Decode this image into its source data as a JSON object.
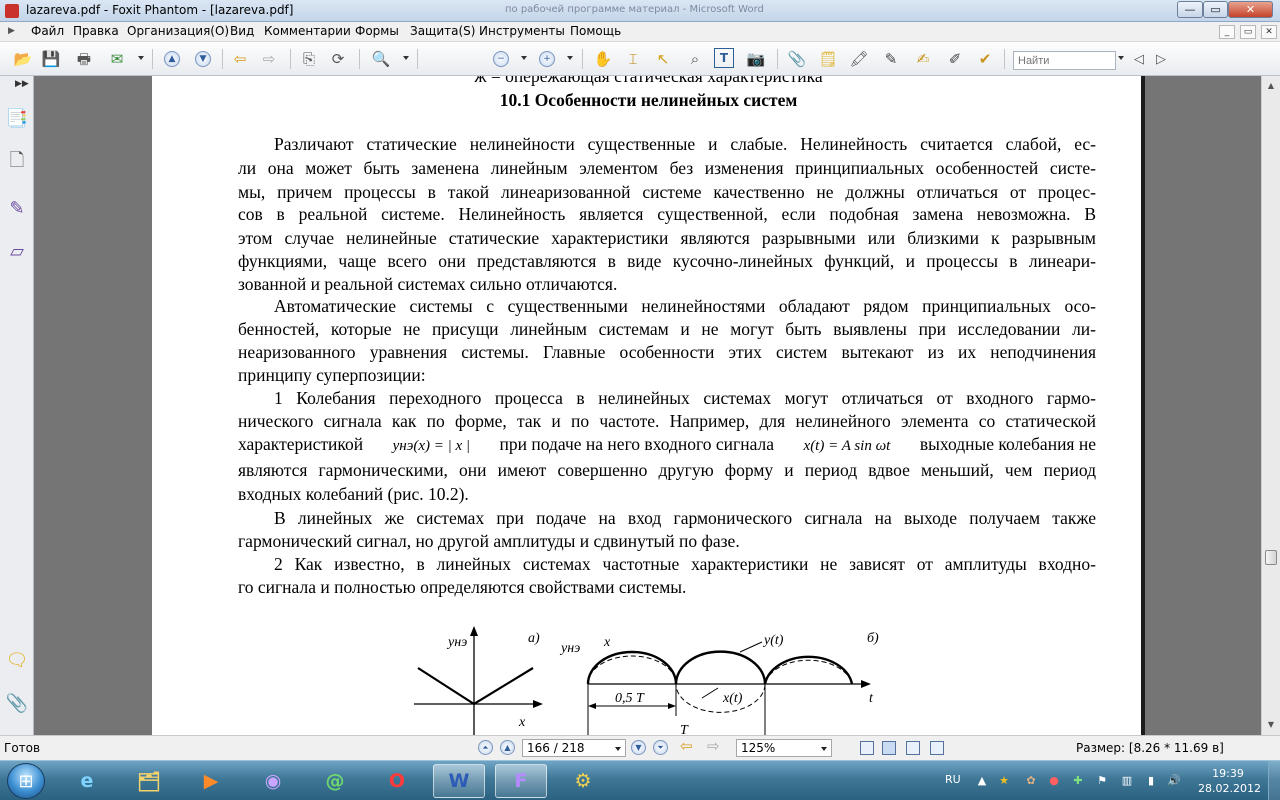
{
  "window": {
    "title": "lazareva.pdf - Foxit Phantom - [lazareva.pdf]",
    "background_title": "по рабочей программе материал - Microsoft Word",
    "min_glyph": "—",
    "max_glyph": "▭",
    "close_glyph": "✕"
  },
  "menu": {
    "items": [
      "Файл",
      "Правка",
      "Организация(О)",
      "Вид",
      "Комментарии",
      "Формы",
      "Защита(S)",
      "Инструменты",
      "Помощь"
    ],
    "mdi_min": "_",
    "mdi_restore": "▭",
    "mdi_close": "✕"
  },
  "toolbar": {
    "search_placeholder": "Найти",
    "icons": [
      "open-icon",
      "save-icon",
      "print-icon",
      "email-icon",
      "prev-page-icon",
      "next-page-icon",
      "back-icon",
      "forward-icon",
      "extract-icon",
      "rotate-icon",
      "zoom-icon",
      "zoom-out-icon",
      "zoom-in-icon",
      "hand-icon",
      "select-text-icon",
      "select-icon",
      "find-icon",
      "typewriter-icon",
      "snapshot-icon",
      "attach-icon",
      "note-icon",
      "highlight-icon",
      "pen-icon",
      "sign-icon"
    ]
  },
  "document": {
    "top_line": "ж = опережающая статическая характеристика",
    "heading": "10.1   Особенности нелинейных систем",
    "lines": [
      "Различают статические нелинейности существенные и слабые. Нелинейность считается слабой, ес-",
      "ли она может быть заменена линейным элементом без изменения принципиальных особенностей систе-",
      "мы, причем процессы в такой линеаризованной системе качественно не должны отличаться от процес-",
      "сов в реальной системе. Нелинейность является существенной, если подобная замена невозможна. В",
      "этом случае нелинейные статические характеристики являются разрывными или близкими к разрывным",
      "функциями, чаще всего они представляются в виде кусочно-линейных функций, и процессы в линеари-",
      "зованной и реальной системах сильно отличаются.",
      "Автоматические системы с существенными нелинейностями обладают рядом принципиальных осо-",
      "бенностей, которые не присущи линейным системам и не могут быть выявлены при исследовании ли-",
      "неаризованного уравнения системы. Главные особенности этих систем вытекают из их неподчинения",
      "принципу суперпозиции:",
      "1   Колебания переходного процесса в нелинейных системах могут отличаться от входного гармо-",
      "нического сигнала как по форме, так и по частоте. Например, для нелинейного элемента со статической",
      "",
      "являются гармоническими, они имеют совершенно другую форму и период вдвое меньший, чем период",
      "входных колебаний (рис. 10.2).",
      "В линейных же системах при подаче на вход гармонического сигнала на выходе получаем также",
      "гармонический сигнал, но другой амплитуды и сдвинутый по фазе.",
      "2   Как известно, в линейных системах частотные характеристики не зависят от амплитуды входно-",
      "го сигнала и полностью определяются свойствами системы."
    ],
    "formula_line": {
      "a": "характеристикой",
      "f1": "yнэ(x) = | x |",
      "b": "при подаче на него входного сигнала",
      "f2": "x(t) = A sin ωt",
      "c": "выходные колебания не"
    },
    "figure": {
      "a_label": "а)",
      "b_label": "б)",
      "yne": "yнэ",
      "x_axis": "x",
      "t_axis": "t",
      "x_label": "x",
      "y_t": "y(t)",
      "x_t": "x(t)",
      "half_T": "0,5 T",
      "T": "T"
    }
  },
  "status": {
    "ready": "Готов",
    "page": "166 / 218",
    "zoom": "125%",
    "size": "Размер: [8.26 * 11.69 в]"
  },
  "taskbar": {
    "apps": [
      "explorer",
      "internet-explorer",
      "file-manager",
      "media-player",
      "torrent",
      "icq",
      "opera",
      "word",
      "foxit",
      "tool"
    ],
    "lang": "RU",
    "time": "19:39",
    "date": "28.02.2012"
  }
}
